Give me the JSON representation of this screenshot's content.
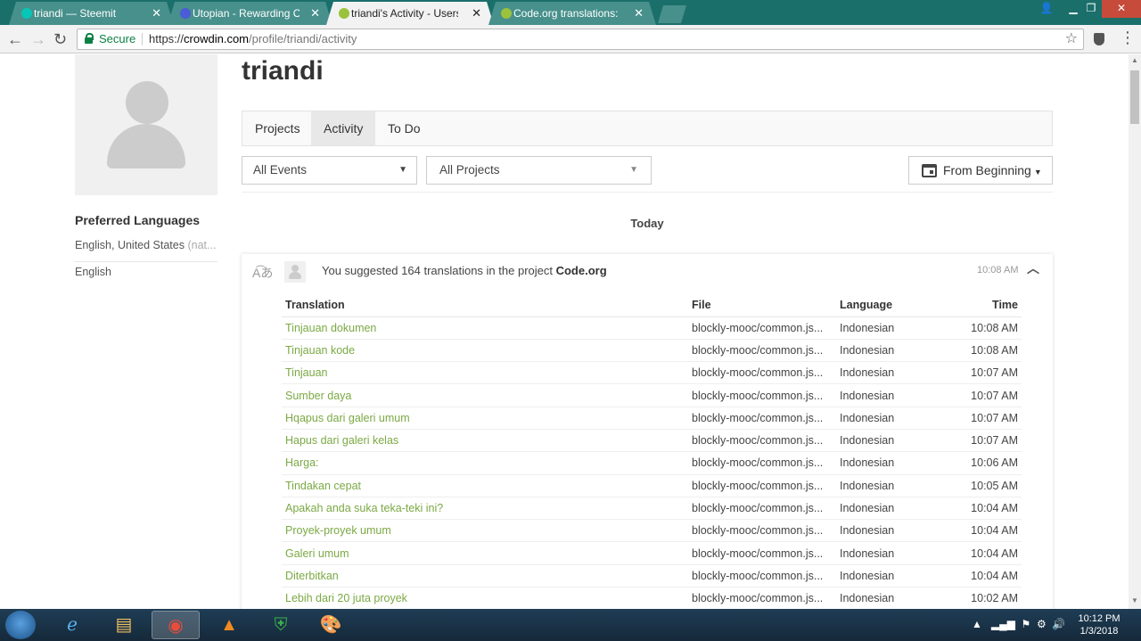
{
  "browser": {
    "tabs": [
      {
        "label": "triandi — Steemit",
        "color": "#07c6b7"
      },
      {
        "label": "Utopian - Rewarding Op",
        "color": "#4a5cd6"
      },
      {
        "label": "triandi's Activity - Users",
        "color": "#9bc23c"
      },
      {
        "label": "Code.org translations: co",
        "color": "#9bc23c"
      }
    ],
    "secure_label": "Secure",
    "url_scheme": "https://",
    "url_host": "crowdin.com",
    "url_path": "/profile/triandi/activity"
  },
  "profile": {
    "username": "triandi",
    "preferred_languages_title": "Preferred Languages",
    "languages": [
      {
        "name": "English, United States",
        "note": "(nat..."
      },
      {
        "name": "English",
        "note": ""
      }
    ]
  },
  "nav": {
    "tabs": [
      "Projects",
      "Activity",
      "To Do"
    ],
    "active": "Activity"
  },
  "filters": {
    "events": "All Events",
    "projects": "All Projects",
    "date": "From Beginning"
  },
  "feed": {
    "day_label": "Today",
    "summary_prefix": "You suggested 164 translations in the project ",
    "project": "Code.org",
    "time": "10:08 AM",
    "columns": [
      "Translation",
      "File",
      "Language",
      "Time"
    ],
    "rows": [
      {
        "translation": "Tinjauan dokumen",
        "file": "blockly-mooc/common.js...",
        "language": "Indonesian",
        "time": "10:08 AM"
      },
      {
        "translation": "Tinjauan kode",
        "file": "blockly-mooc/common.js...",
        "language": "Indonesian",
        "time": "10:08 AM"
      },
      {
        "translation": "Tinjauan",
        "file": "blockly-mooc/common.js...",
        "language": "Indonesian",
        "time": "10:07 AM"
      },
      {
        "translation": "Sumber daya",
        "file": "blockly-mooc/common.js...",
        "language": "Indonesian",
        "time": "10:07 AM"
      },
      {
        "translation": "Hqapus dari galeri umum",
        "file": "blockly-mooc/common.js...",
        "language": "Indonesian",
        "time": "10:07 AM"
      },
      {
        "translation": "Hapus dari galeri kelas",
        "file": "blockly-mooc/common.js...",
        "language": "Indonesian",
        "time": "10:07 AM"
      },
      {
        "translation": "Harga:",
        "file": "blockly-mooc/common.js...",
        "language": "Indonesian",
        "time": "10:06 AM"
      },
      {
        "translation": "Tindakan cepat",
        "file": "blockly-mooc/common.js...",
        "language": "Indonesian",
        "time": "10:05 AM"
      },
      {
        "translation": "Apakah anda suka teka-teki ini?",
        "file": "blockly-mooc/common.js...",
        "language": "Indonesian",
        "time": "10:04 AM"
      },
      {
        "translation": "Proyek-proyek umum",
        "file": "blockly-mooc/common.js...",
        "language": "Indonesian",
        "time": "10:04 AM"
      },
      {
        "translation": "Galeri umum",
        "file": "blockly-mooc/common.js...",
        "language": "Indonesian",
        "time": "10:04 AM"
      },
      {
        "translation": "Diterbitkan",
        "file": "blockly-mooc/common.js...",
        "language": "Indonesian",
        "time": "10:04 AM"
      },
      {
        "translation": "Lebih dari 20 juta proyek",
        "file": "blockly-mooc/common.js...",
        "language": "Indonesian",
        "time": "10:02 AM"
      }
    ]
  },
  "taskbar": {
    "time": "10:12 PM",
    "date": "1/3/2018"
  },
  "colors": {
    "tabbar": "#1b6f6b",
    "translation_link": "#7ba944",
    "secure_green": "#0b8043"
  }
}
